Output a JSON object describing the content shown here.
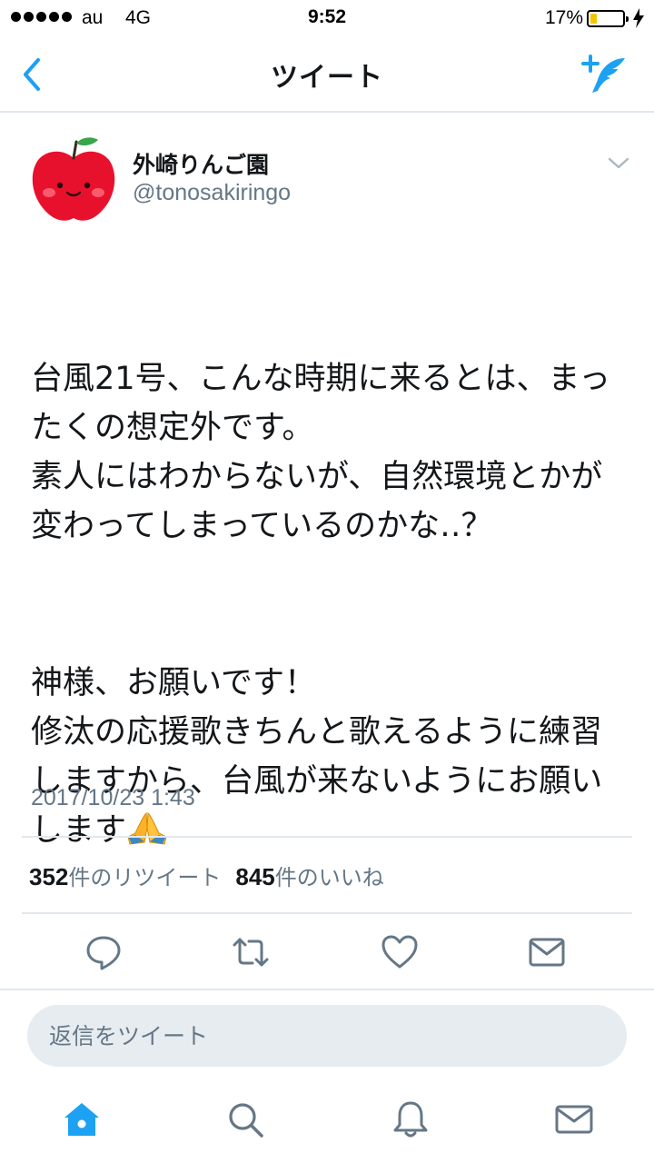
{
  "status_bar": {
    "carrier": "au",
    "network": "4G",
    "time": "9:52",
    "battery_percent": "17%",
    "battery_level": 0.17,
    "battery_color": "#f5c400"
  },
  "nav": {
    "title": "ツイート",
    "back_icon": "chevron-left-icon",
    "compose_icon": "compose-tweet-icon",
    "accent_color": "#1da1f2"
  },
  "tweet": {
    "display_name": "外崎りんご園",
    "handle": "@tonosakiringo",
    "avatar_icon": "apple-avatar-icon",
    "paragraphs": [
      "台風21号、こんな時期に来るとは、まったくの想定外です。\n素人にはわからないが、自然環境とかが変わってしまっているのかな‥？",
      "神様、お願いです！\n修汰の応援歌きちんと歌えるように練習しますから、台風が来ないようにお願いします"
    ],
    "emoji": "🙏",
    "timestamp": "2017/10/23 1:43",
    "retweet_count": "352",
    "retweet_label": "件のリツイート",
    "like_count": "845",
    "like_label": "件のいいね"
  },
  "actions": [
    "reply-icon",
    "retweet-icon",
    "like-icon",
    "message-icon"
  ],
  "reply_box": {
    "placeholder": "返信をツイート"
  },
  "tab_bar": [
    "home-icon",
    "search-icon",
    "notifications-icon",
    "messages-icon"
  ]
}
